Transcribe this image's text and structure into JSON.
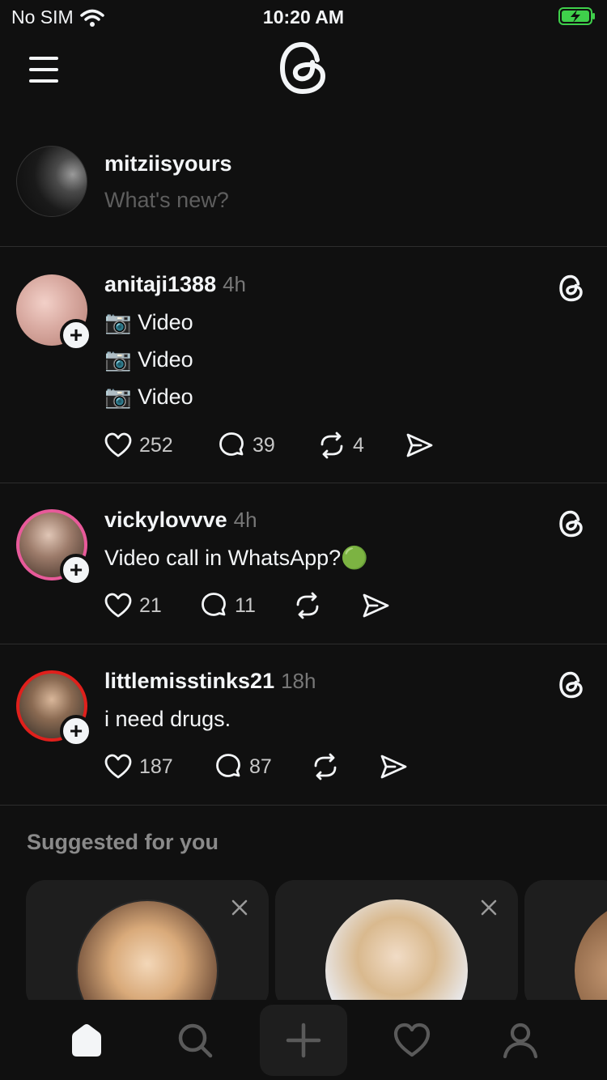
{
  "status_bar": {
    "carrier": "No SIM",
    "time": "10:20 AM"
  },
  "composer": {
    "username": "mitziisyours",
    "placeholder": "What's new?"
  },
  "posts": [
    {
      "username": "anitaji1388",
      "time": "4h",
      "lines": [
        "📷 Video",
        "📷 Video",
        "📷 Video"
      ],
      "likes": "252",
      "replies": "39",
      "reposts": "4",
      "avatar_ring": "none"
    },
    {
      "username": "vickylovvve",
      "time": "4h",
      "lines": [
        "Video call in WhatsApp?🟢"
      ],
      "likes": "21",
      "replies": "11",
      "reposts": "",
      "avatar_ring": "#e85a9a"
    },
    {
      "username": "littlemisstinks21",
      "time": "18h",
      "lines": [
        "i need drugs."
      ],
      "likes": "187",
      "replies": "87",
      "reposts": "",
      "avatar_ring": "#e0201c"
    }
  ],
  "suggested": {
    "title": "Suggested for you"
  },
  "colors": {
    "background": "#101010",
    "text": "#f3f5f7",
    "muted": "#777777",
    "battery": "#3fd04b"
  },
  "icons": {
    "menu": "hamburger-icon",
    "logo": "threads-logo-icon",
    "like": "heart-icon",
    "reply": "comment-icon",
    "repost": "repost-icon",
    "share": "send-icon",
    "home": "home-icon",
    "search": "search-icon",
    "create": "plus-icon",
    "activity": "heart-icon",
    "profile": "person-icon"
  }
}
